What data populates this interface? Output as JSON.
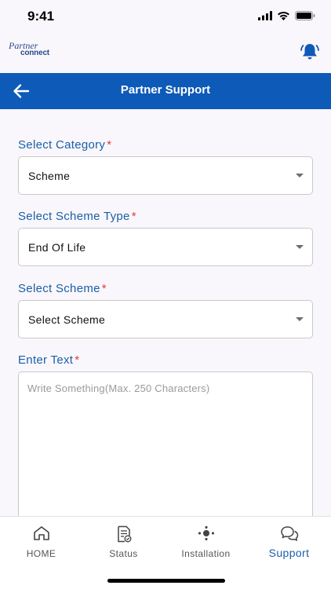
{
  "status": {
    "time": "9:41"
  },
  "header": {
    "logo_line1": "Partner",
    "logo_line2": "connect"
  },
  "titlebar": {
    "title": "Partner Support"
  },
  "form": {
    "category": {
      "label": "Select Category",
      "required": "*",
      "value": "Scheme"
    },
    "scheme_type": {
      "label": "Select Scheme Type",
      "required": "*",
      "value": "End Of Life"
    },
    "scheme": {
      "label": "Select Scheme",
      "required": "*",
      "value": "Select Scheme"
    },
    "text": {
      "label": "Enter Text",
      "required": "*",
      "placeholder": "Write Something(Max. 250 Characters)"
    }
  },
  "nav": {
    "items": [
      {
        "label": "HOME",
        "icon": "home-icon"
      },
      {
        "label": "Status",
        "icon": "document-status-icon"
      },
      {
        "label": "Installation",
        "icon": "installation-icon"
      },
      {
        "label": "Support",
        "icon": "chat-bubbles-icon",
        "active": true
      }
    ]
  },
  "colors": {
    "primary": "#0e5ab8",
    "label": "#1a5fa8",
    "required": "#e23b3b"
  }
}
